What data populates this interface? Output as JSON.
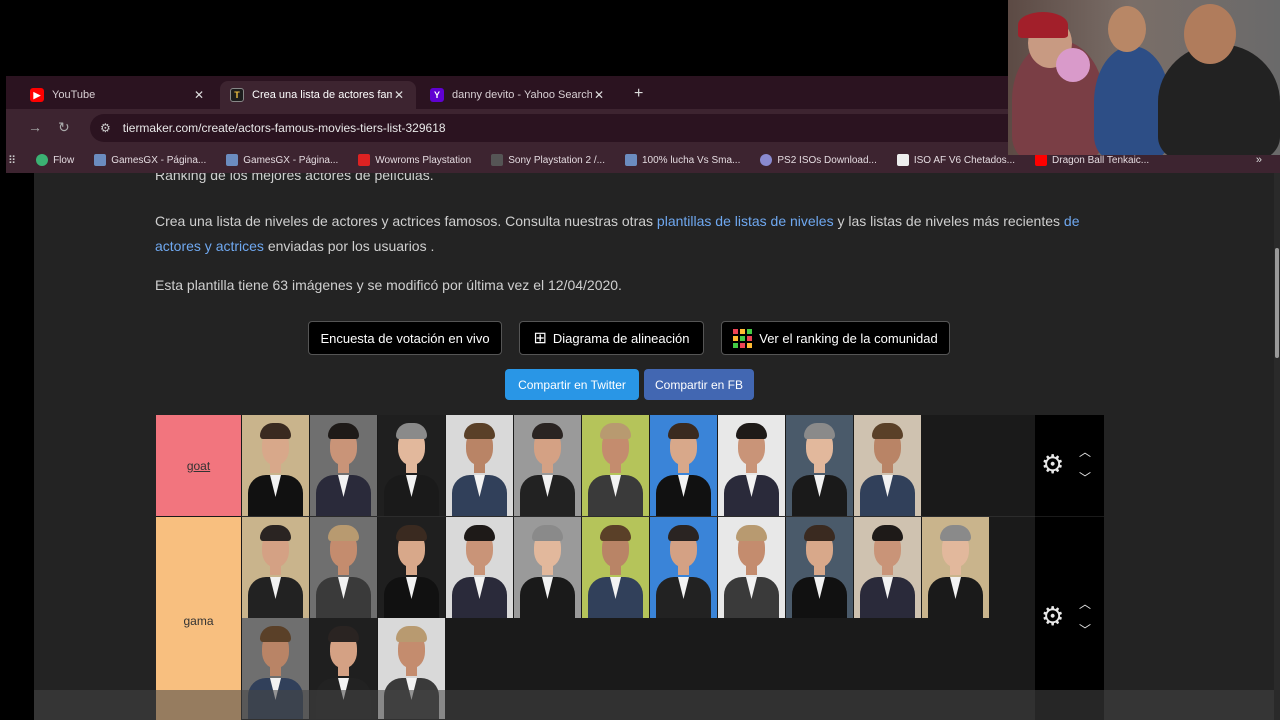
{
  "browser": {
    "tabs": [
      {
        "label": "YouTube",
        "icon": "youtube-icon"
      },
      {
        "label": "Crea una lista de actores famos",
        "icon": "tiermaker-icon"
      },
      {
        "label": "danny devito - Yahoo Search Tı",
        "icon": "yahoo-icon"
      }
    ],
    "url": "tiermaker.com/create/actors-famous-movies-tiers-list-329618",
    "bookmarks": [
      "Flow",
      "GamesGX - Página...",
      "GamesGX - Página...",
      "Wowroms Playstation",
      "Sony Playstation 2 /...",
      "100% lucha Vs Sma...",
      "PS2 ISOs Download...",
      "ISO AF V6 Chetados...",
      "Dragon Ball Tenkaic..."
    ]
  },
  "page": {
    "cut_text": "Ranking de los mejores actores de películas.",
    "para": {
      "part1": "Crea una lista de niveles de actores y actrices famosos. Consulta nuestras otras ",
      "link1": "plantillas de listas de niveles",
      "part2": " y las listas de niveles más recientes ",
      "link2": "de actores y actrices",
      "part3": " enviadas por los usuarios ."
    },
    "info": "Esta plantilla tiene 63 imágenes y se modificó por última vez el 12/04/2020.",
    "buttons": {
      "live_poll": "Encuesta de votación en vivo",
      "alignment": "Diagrama de alineación",
      "community": "Ver el ranking de la comunidad"
    },
    "share": {
      "twitter": "Compartir en Twitter",
      "facebook": "Compartir en FB"
    }
  },
  "tiers": [
    {
      "label": "goat",
      "color": "#f2757e",
      "count": 10
    },
    {
      "label": "gama",
      "color": "#f8bf7f",
      "count": 14
    }
  ],
  "colors": {
    "page_bg": "#232323",
    "link": "#6fa8f0",
    "twitter": "#2996e6",
    "facebook": "#4267b2"
  }
}
